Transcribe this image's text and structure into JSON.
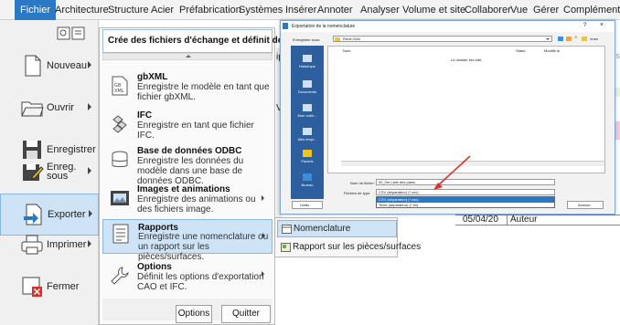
{
  "ribbon": {
    "tabs": [
      "Fichier",
      "Architecture",
      "Structure",
      "Acier",
      "Préfabrication",
      "Systèmes",
      "Insérer",
      "Annoter",
      "Analyser",
      "Volume et site",
      "Collaborer",
      "Vue",
      "Gérer",
      "Compléments"
    ]
  },
  "app_menu": {
    "items": [
      {
        "label": "Nouveau",
        "has_arrow": true
      },
      {
        "label": "Ouvrir",
        "has_arrow": true
      },
      {
        "label": "Enregistrer",
        "has_arrow": false
      },
      {
        "label": "Enreg. sous",
        "has_arrow": true
      },
      {
        "label": "Exporter",
        "has_arrow": true,
        "active": true
      },
      {
        "label": "Imprimer",
        "has_arrow": true
      },
      {
        "label": "Fermer",
        "has_arrow": false
      }
    ]
  },
  "export_panel": {
    "title": "Crée des fichiers d'échange et définit des options.",
    "items": [
      {
        "title": "gbXML",
        "desc": "Enregistre le modèle en tant que fichier gbXML."
      },
      {
        "title": "IFC",
        "desc": "Enregistre en tant que fichier IFC."
      },
      {
        "title": "Base de données ODBC",
        "desc": "Enregistre les données du modèle dans une base de données ODBC."
      },
      {
        "title": "Images et animations",
        "desc": "Enregistre des animations ou des fichiers image."
      },
      {
        "title": "Rapports",
        "desc": "Enregistre une nomenclature ou un rapport sur les pièces/surfaces."
      },
      {
        "title": "Options",
        "desc": "Définit les options d'exportation CAO et IFC."
      }
    ],
    "options_button": "Options",
    "quit_button": "Quitter Revit"
  },
  "rapports_flyout": {
    "items": [
      "Nomenclature",
      "Rapport sur les pièces/surfaces"
    ]
  },
  "dialog": {
    "title": "Exportation de la nomenclature",
    "save_in_label": "Enregistrer sous:",
    "save_in_value": "Revit-CM4",
    "col_name": "Nom",
    "col_status": "Statut",
    "col_modified": "Modifié le",
    "empty_text": "Le dossier est vide.",
    "filename_label": "Nom de fichier:",
    "filename_value": "00_0m Liste des plans",
    "filetype_label": "Fichiers de type:",
    "filetype_value": "CSV (séparateur) (*.csv)",
    "filetype_options": [
      "CSV (séparateur) (*.csv)",
      "Texte (séparateur) (*.txt)"
    ],
    "sidebar_items": [
      "Historique",
      "Documents",
      "Mon ordin...",
      "Mes empl...",
      "Favoris",
      "Bureau"
    ],
    "tools_button": "Outils",
    "cancel_button": "Annuler",
    "views_label": "Vues",
    "title_controls": [
      "?",
      "×"
    ]
  },
  "background": {
    "date_text": "05/04/20",
    "author_text": "Auteur",
    "fragments": [
      "ipr",
      "Vu",
      "mens",
      "lar"
    ]
  },
  "colors": {
    "accent": "#2b78c5",
    "highlight": "#cfe3f7",
    "arrow": "#e0302b"
  }
}
